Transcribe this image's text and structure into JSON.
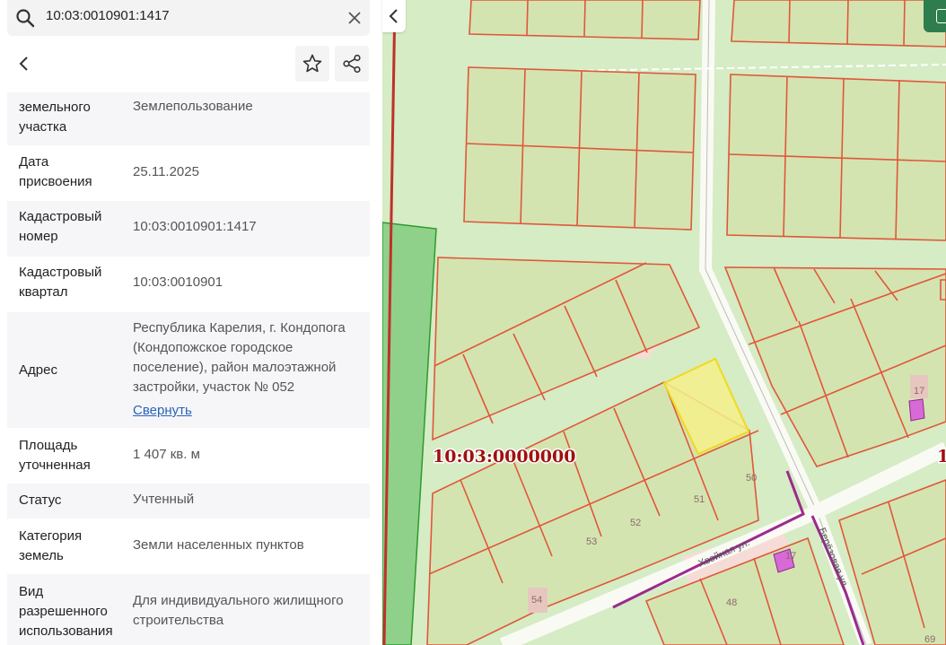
{
  "search": {
    "query": "10:03:0010901:1417"
  },
  "info_rows": [
    {
      "label": "земельного\nучастка",
      "value": "Землепользование"
    },
    {
      "label": "Дата\nприсвоения",
      "value": "25.11.2025"
    },
    {
      "label": "Кадастровый\nномер",
      "value": "10:03:0010901:1417"
    },
    {
      "label": "Кадастровый\nквартал",
      "value": "10:03:0010901"
    },
    {
      "label": "Адрес",
      "value": "Республика Карелия, г. Кондопога\n(Кондопожское городское\nпоселение), район малоэтажной\nзастройки, участок № 052",
      "link": "Свернуть"
    },
    {
      "label": "Площадь\nуточненная",
      "value": "1 407 кв. м"
    },
    {
      "label": "Статус",
      "value": "Учтенный"
    },
    {
      "label": "Категория\nземель",
      "value": "Земли населенных пунктов"
    },
    {
      "label": "Вид\nразрешенного\nиспользования",
      "value": "Для индивидуального жилищного\nстроительства"
    }
  ],
  "map": {
    "quarter_label": "10:03:0000000",
    "edge_label": "1",
    "parcel_numbers": [
      "50",
      "51",
      "52",
      "53",
      "54",
      "48",
      "17",
      "17",
      "69"
    ],
    "street_labels": [
      "Хвойная ул.",
      "Берёзовая ул."
    ],
    "colors": {
      "base": "#d5ecc5",
      "parcel_fill": "#d4e4b0",
      "parcel_stroke": "#e0573a",
      "selected_fill": "#f4f08a",
      "selected_stroke": "#f2d91c",
      "forest": "#8fd18a",
      "road": "#fafaf5",
      "line_purple": "#9b2a8e",
      "building": "#d86ad8",
      "label_red": "#a01010"
    }
  },
  "icons": [
    "search-icon",
    "close-icon",
    "chevron-left-icon",
    "star-icon",
    "share-icon"
  ]
}
